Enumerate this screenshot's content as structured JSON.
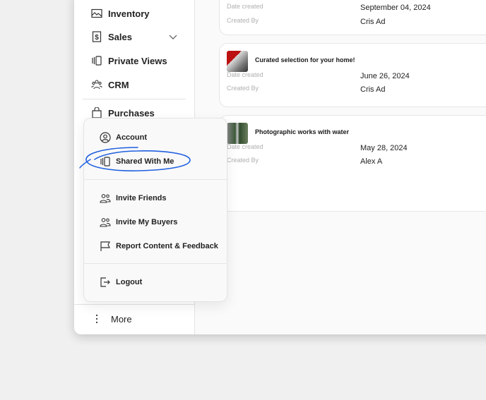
{
  "sidebar": {
    "items": [
      {
        "label": "Inventory",
        "icon": "image-icon"
      },
      {
        "label": "Sales",
        "icon": "dollar-receipt-icon"
      },
      {
        "label": "Private Views",
        "icon": "private-views-icon"
      },
      {
        "label": "CRM",
        "icon": "people-group-icon"
      },
      {
        "label": "Purchases",
        "icon": "shopping-bag-icon"
      }
    ],
    "more": "More"
  },
  "menu": {
    "items": [
      {
        "label": "Account",
        "icon": "user-circle-icon"
      },
      {
        "label": "Shared With Me",
        "icon": "shared-icon"
      },
      {
        "label": "Invite Friends",
        "icon": "users-icon"
      },
      {
        "label": "Invite My Buyers",
        "icon": "users-icon"
      },
      {
        "label": "Report Content & Feedback",
        "icon": "flag-icon"
      },
      {
        "label": "Logout",
        "icon": "logout-icon"
      }
    ],
    "annotation_color": "#1f5fe0"
  },
  "cards": [
    {
      "title": "",
      "date_label": "Date created",
      "date": "September 04, 2024",
      "by_label": "Created By",
      "by": "Cris Ad"
    },
    {
      "title": "Curated selection for your home!",
      "date_label": "Date created",
      "date": "June 26, 2024",
      "by_label": "Created By",
      "by": "Cris Ad"
    },
    {
      "title": "Photographic works with water",
      "date_label": "Date created",
      "date": "May 28, 2024",
      "by_label": "Created By",
      "by": "Alex A"
    }
  ]
}
